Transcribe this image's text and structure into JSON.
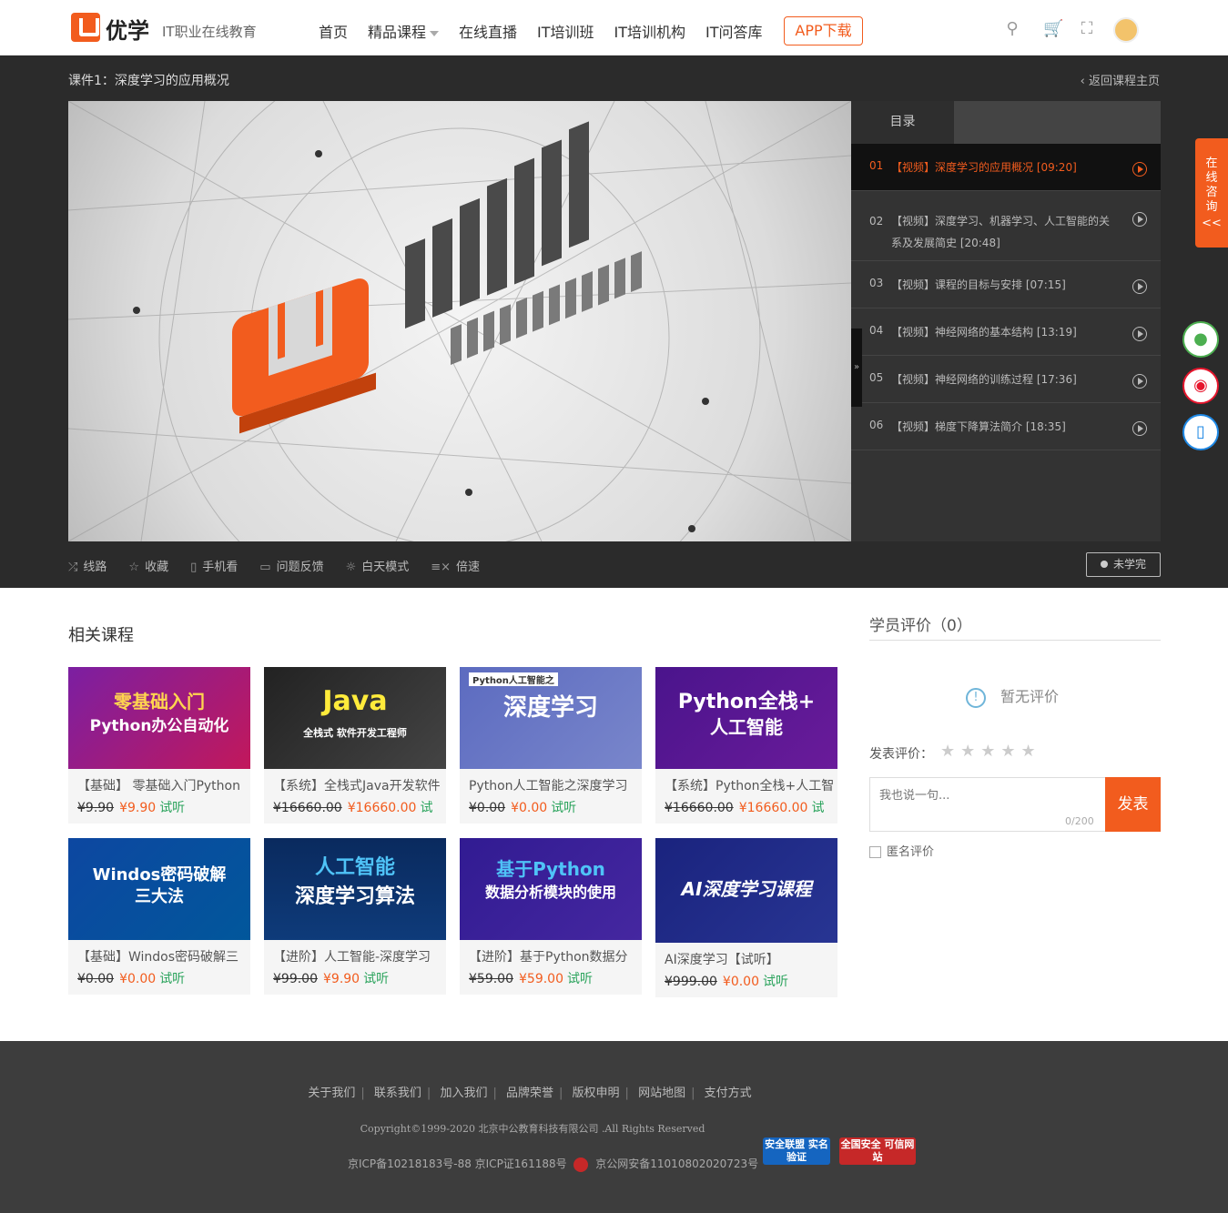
{
  "header": {
    "brand": "优学",
    "slogan": "IT职业在线教育",
    "nav": [
      "首页",
      "精品课程",
      "在线直播",
      "IT培训班",
      "IT培训机构",
      "IT问答库"
    ],
    "app_button": "APP下载",
    "icons": [
      "search-icon",
      "cart-icon",
      "scan-icon",
      "avatar"
    ]
  },
  "player": {
    "lesson_title": "课件1：深度学习的应用概况",
    "back_link": "返回课程主页",
    "catalog_tab": "目录",
    "lessons": [
      {
        "num": "01",
        "title": "【视频】深度学习的应用概况 [09:20]",
        "active": true
      },
      {
        "num": "02",
        "title": "【视频】深度学习、机器学习、人工智能的关系及发展简史 [20:48]",
        "active": false
      },
      {
        "num": "03",
        "title": "【视频】课程的目标与安排 [07:15]",
        "active": false
      },
      {
        "num": "04",
        "title": "【视频】神经网络的基本结构 [13:19]",
        "active": false
      },
      {
        "num": "05",
        "title": "【视频】神经网络的训练过程 [17:36]",
        "active": false
      },
      {
        "num": "06",
        "title": "【视频】梯度下降算法简介 [18:35]",
        "active": false
      }
    ],
    "toolbar": [
      "线路",
      "收藏",
      "手机看",
      "问题反馈",
      "白天模式",
      "倍速"
    ],
    "status_button": "未学完",
    "collapse_glyph": "»"
  },
  "side": {
    "consult": "在线咨询",
    "consult_arrow": "<<"
  },
  "related": {
    "title": "相关课程",
    "courses": [
      {
        "name": "【基础】 零基础入门Python",
        "old": "¥9.90",
        "new": "¥9.90",
        "try": "试听",
        "thumb_t1": "零基础入门",
        "thumb_t2": "Python办公自动化"
      },
      {
        "name": "【系统】全栈式Java开发软件",
        "old": "¥16660.00",
        "new": "¥16660.00",
        "try": "试",
        "thumb_t1": "Java",
        "thumb_t2": "全栈式 软件开发工程师"
      },
      {
        "name": "Python人工智能之深度学习",
        "old": "¥0.00",
        "new": "¥0.00",
        "try": "试听",
        "thumb_t1": "深度学习",
        "thumb_t2": "Python人工智能之"
      },
      {
        "name": "【系统】Python全栈+人工智",
        "old": "¥16660.00",
        "new": "¥16660.00",
        "try": "试",
        "thumb_t1": "Python全栈+",
        "thumb_t2": "人工智能"
      },
      {
        "name": "【基础】Windos密码破解三",
        "old": "¥0.00",
        "new": "¥0.00",
        "try": "试听",
        "thumb_t1": "Windos密码破解",
        "thumb_t2": "三大法"
      },
      {
        "name": "【进阶】人工智能-深度学习",
        "old": "¥99.00",
        "new": "¥9.90",
        "try": "试听",
        "thumb_t1": "人工智能",
        "thumb_t2": "深度学习算法"
      },
      {
        "name": "【进阶】基于Python数据分",
        "old": "¥59.00",
        "new": "¥59.00",
        "try": "试听",
        "thumb_t1": "基于Python",
        "thumb_t2": "数据分析模块的使用"
      },
      {
        "name": "AI深度学习【试听】",
        "old": "¥999.00",
        "new": "¥0.00",
        "try": "试听",
        "thumb_t1": "AI深度学习课程",
        "thumb_t2": ""
      }
    ]
  },
  "reviews": {
    "title": "学员评价（0）",
    "empty": "暂无评价",
    "rate_label": "发表评价：",
    "stars": "★★★★★",
    "placeholder": "我也说一句...",
    "counter": "0/200",
    "submit": "发表",
    "anonymous": "匿名评价"
  },
  "footer": {
    "links": [
      "关于我们",
      "联系我们",
      "加入我们",
      "品牌荣誉",
      "版权申明",
      "网站地图",
      "支付方式"
    ],
    "copyright": "Copyright©1999-2020 北京中公教育科技有限公司 .All Rights Reserved",
    "icp": "京ICP备10218183号-88 京ICP证161188号",
    "police": "京公网安备11010802020723号",
    "badge1": "安全联盟 实名验证",
    "badge2": "全国安全 可信网站"
  },
  "colors": {
    "accent": "#f25c1e",
    "dark": "#2b2b2b",
    "footer": "#3d3d3d",
    "green": "#2aa35c"
  }
}
